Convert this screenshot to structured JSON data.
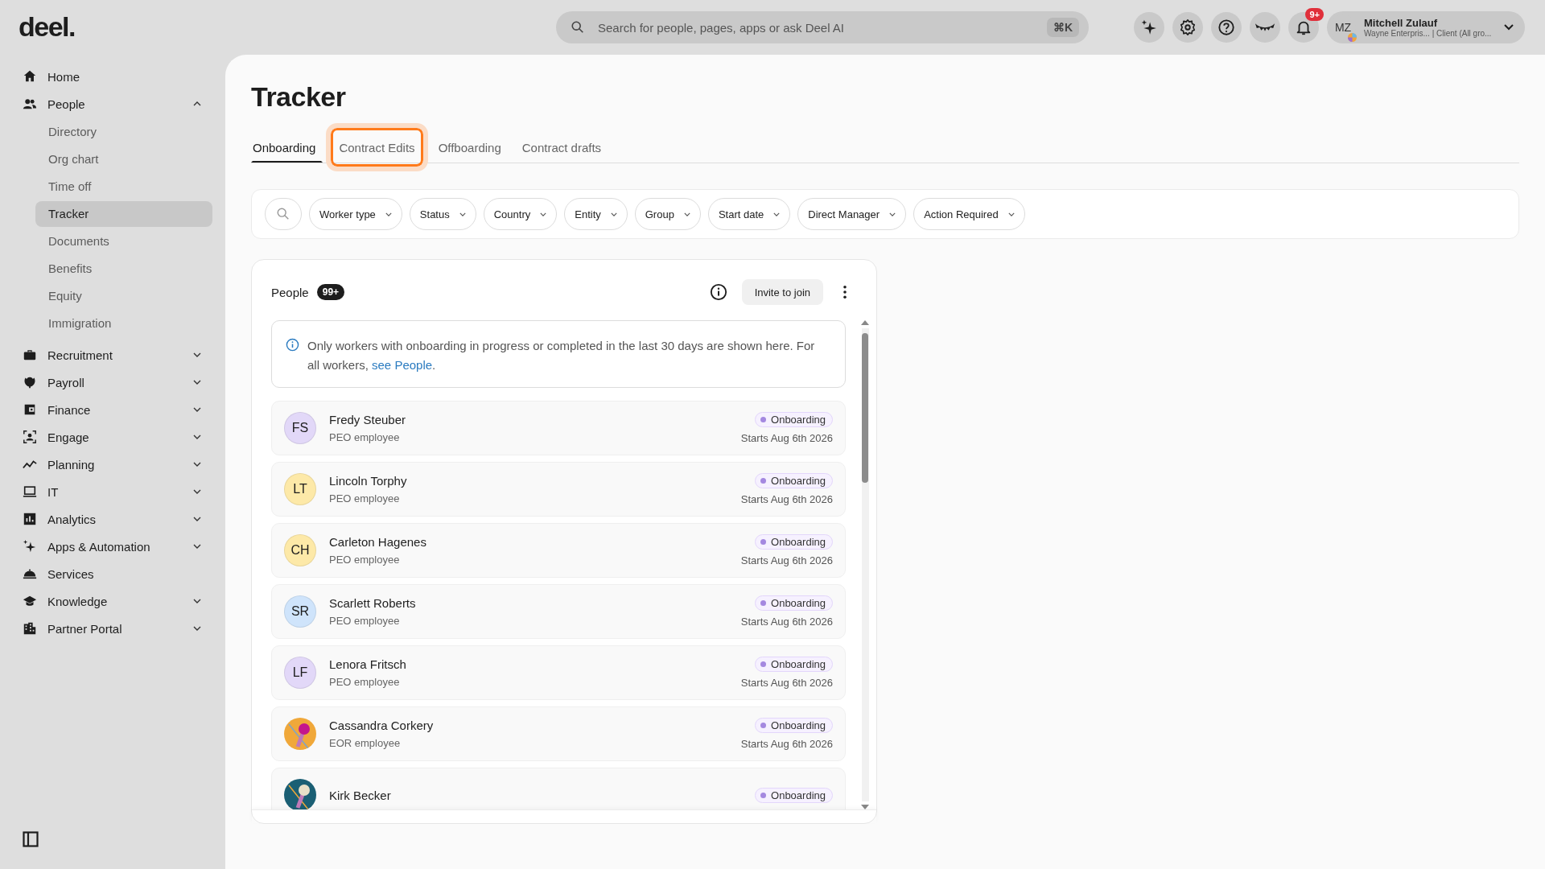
{
  "logo": "deel.",
  "search": {
    "placeholder": "Search for people, pages, apps or ask Deel AI",
    "shortcut": "⌘K"
  },
  "notifications": {
    "badge": "9+"
  },
  "user": {
    "initials": "MZ",
    "name": "Mitchell Zulauf",
    "org": "Wayne Enterpris... | Client (All gro..."
  },
  "sidebar": {
    "items": [
      {
        "label": "Home"
      },
      {
        "label": "People",
        "expanded": true,
        "children": [
          {
            "label": "Directory",
            "selected": false
          },
          {
            "label": "Org chart",
            "selected": false
          },
          {
            "label": "Time off",
            "selected": false
          },
          {
            "label": "Tracker",
            "selected": true
          },
          {
            "label": "Documents",
            "selected": false
          },
          {
            "label": "Benefits",
            "selected": false
          },
          {
            "label": "Equity",
            "selected": false
          },
          {
            "label": "Immigration",
            "selected": false
          }
        ]
      },
      {
        "label": "Recruitment",
        "expanded": false
      },
      {
        "label": "Payroll",
        "expanded": false
      },
      {
        "label": "Finance",
        "expanded": false
      },
      {
        "label": "Engage",
        "expanded": false
      },
      {
        "label": "Planning",
        "expanded": false
      },
      {
        "label": "IT",
        "expanded": false
      },
      {
        "label": "Analytics",
        "expanded": false
      },
      {
        "label": "Apps & Automation",
        "expanded": false
      },
      {
        "label": "Services"
      },
      {
        "label": "Knowledge",
        "expanded": false
      },
      {
        "label": "Partner Portal",
        "expanded": false
      }
    ]
  },
  "page": {
    "title": "Tracker"
  },
  "tabs": [
    {
      "label": "Onboarding",
      "selected": true,
      "focused": false
    },
    {
      "label": "Contract Edits",
      "selected": false,
      "focused": true
    },
    {
      "label": "Offboarding",
      "selected": false,
      "focused": false
    },
    {
      "label": "Contract drafts",
      "selected": false,
      "focused": false
    }
  ],
  "filters": [
    "Worker type",
    "Status",
    "Country",
    "Entity",
    "Group",
    "Start date",
    "Direct Manager",
    "Action Required"
  ],
  "people_card": {
    "title": "People",
    "count": "99+",
    "invite_button": "Invite to join",
    "notice": {
      "text": "Only workers with onboarding in progress or completed in the last 30 days are shown here. For all workers, ",
      "link": "see People",
      "after": "."
    },
    "rows": [
      {
        "name": "Fredy Steuber",
        "type": "PEO employee",
        "status": "Onboarding",
        "date": "Starts Aug 6th 2026",
        "avatar": {
          "kind": "initials",
          "initials": "FS",
          "color": "#e2d8f8"
        }
      },
      {
        "name": "Lincoln Torphy",
        "type": "PEO employee",
        "status": "Onboarding",
        "date": "Starts Aug 6th 2026",
        "avatar": {
          "kind": "initials",
          "initials": "LT",
          "color": "#fde9a8"
        }
      },
      {
        "name": "Carleton Hagenes",
        "type": "PEO employee",
        "status": "Onboarding",
        "date": "Starts Aug 6th 2026",
        "avatar": {
          "kind": "initials",
          "initials": "CH",
          "color": "#fde9a8"
        }
      },
      {
        "name": "Scarlett Roberts",
        "type": "PEO employee",
        "status": "Onboarding",
        "date": "Starts Aug 6th 2026",
        "avatar": {
          "kind": "initials",
          "initials": "SR",
          "color": "#cfe4fb"
        }
      },
      {
        "name": "Lenora Fritsch",
        "type": "PEO employee",
        "status": "Onboarding",
        "date": "Starts Aug 6th 2026",
        "avatar": {
          "kind": "initials",
          "initials": "LF",
          "color": "#e2d8f8"
        }
      },
      {
        "name": "Cassandra Corkery",
        "type": "EOR employee",
        "status": "Onboarding",
        "date": "Starts Aug 6th 2026"
      },
      {
        "name": "Kirk Becker",
        "status": "Onboarding"
      }
    ]
  }
}
